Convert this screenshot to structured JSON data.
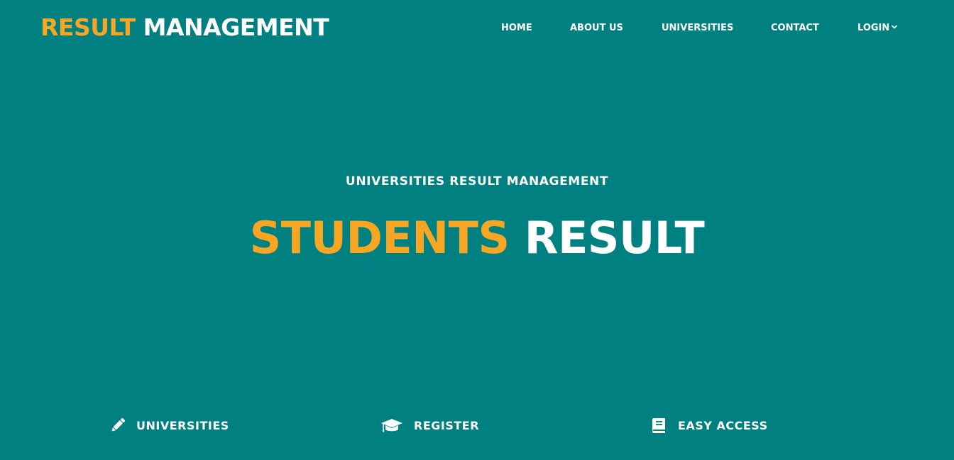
{
  "header": {
    "logo_accent": "RESULT",
    "logo_main": "MANAGEMENT"
  },
  "nav": {
    "items": [
      {
        "label": "HOME"
      },
      {
        "label": "ABOUT US"
      },
      {
        "label": "UNIVERSITIES"
      },
      {
        "label": "CONTACT"
      },
      {
        "label": "LOGIN",
        "icon": "chevron-down-icon"
      }
    ]
  },
  "hero": {
    "subtitle": "UNIVERSITIES RESULT MANAGEMENT",
    "title_accent": "STUDENTS",
    "title_main": "RESULT"
  },
  "features": [
    {
      "label": "UNIVERSITIES",
      "icon": "pencil-icon"
    },
    {
      "label": "REGISTER",
      "icon": "graduation-cap-icon"
    },
    {
      "label": "EASY ACCESS",
      "icon": "book-icon"
    }
  ],
  "colors": {
    "background": "#008080",
    "accent": "#f6a623",
    "text": "#ffffff"
  }
}
